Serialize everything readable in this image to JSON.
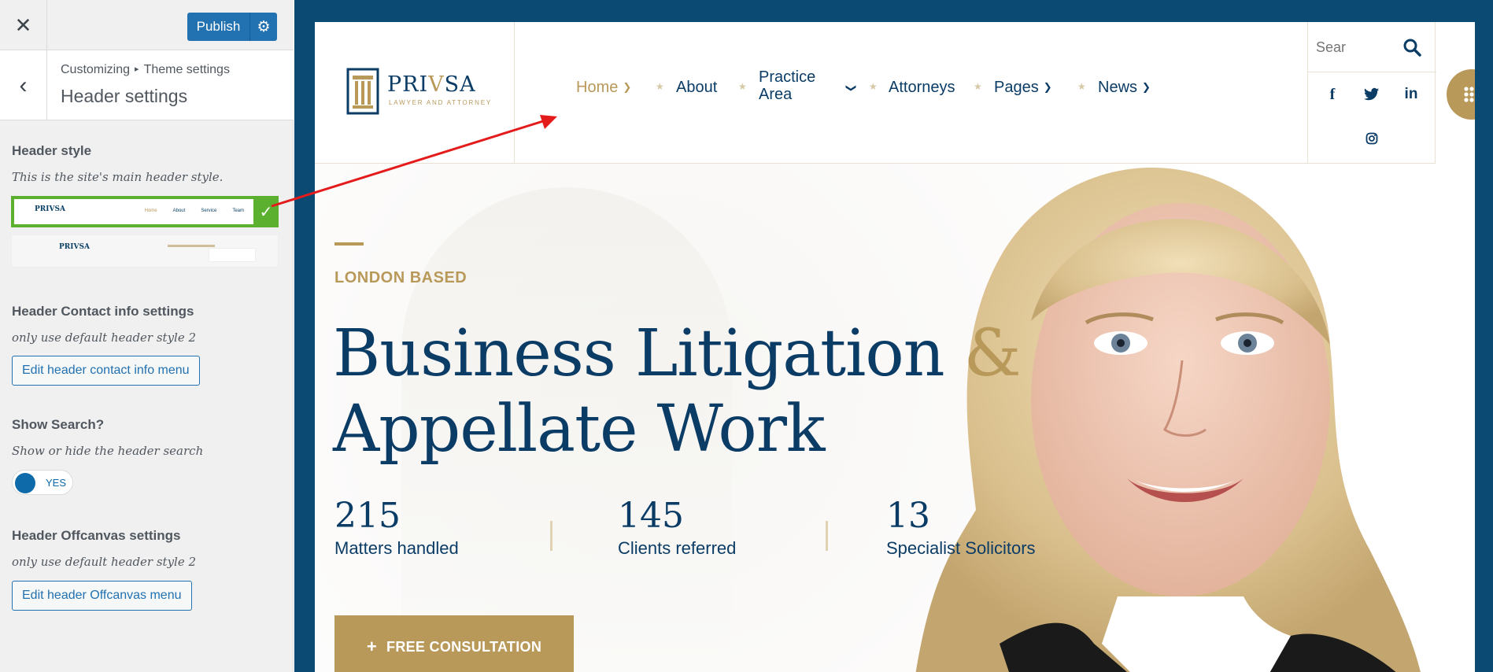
{
  "customizer": {
    "close_icon": "close-icon",
    "publish_label": "Publish",
    "gear_icon": "gear-icon",
    "back_icon": "chevron-left-icon",
    "breadcrumb": {
      "root": "Customizing",
      "separator": "▸",
      "parent": "Theme settings"
    },
    "section_title": "Header settings",
    "header_style": {
      "title": "Header style",
      "description": "This is the site's main header style.",
      "option_1_logo": "PRIVSA",
      "option_1_nav": [
        "Home",
        "About",
        "Service",
        "Team"
      ],
      "option_2_logo": "PRIVSA",
      "selected_option": 1
    },
    "contact_info": {
      "title": "Header Contact info settings",
      "description": "only use default header style 2",
      "button_label": "Edit header contact info menu"
    },
    "search": {
      "title": "Show Search?",
      "description": "Show or hide the header search",
      "toggle_label": "YES",
      "enabled": true
    },
    "offcanvas": {
      "title": "Header Offcanvas settings",
      "description": "only use default header style 2",
      "button_label": "Edit header Offcanvas menu"
    }
  },
  "site": {
    "logo": {
      "name_pre": "PRI",
      "name_v": "V",
      "name_post": "SA",
      "tagline": "LAWYER AND ATTORNEY"
    },
    "nav": [
      {
        "label": "Home",
        "has_dropdown": true,
        "active": true
      },
      {
        "label": "About",
        "has_dropdown": false
      },
      {
        "label": "Practice",
        "label2": "Area",
        "has_dropdown": true
      },
      {
        "label": "Attorneys",
        "has_dropdown": false
      },
      {
        "label": "Pages",
        "has_dropdown": true
      },
      {
        "label": "News",
        "has_dropdown": true
      }
    ],
    "search_placeholder": "Sear",
    "social": [
      "f",
      "twitter",
      "in",
      "instagram"
    ],
    "hero": {
      "kicker": "LONDON BASED",
      "headline_line1": "Business Litigation",
      "headline_amp": "&",
      "headline_line2": "Appellate Work",
      "stats": [
        {
          "number": "215",
          "label": "Matters handled"
        },
        {
          "number": "145",
          "label": "Clients referred"
        },
        {
          "number": "13",
          "label": "Specialist Solicitors"
        }
      ],
      "cta_icon": "+",
      "cta_label": "FREE CONSULTATION"
    },
    "colors": {
      "navy": "#0b3c66",
      "gold": "#b8995a",
      "frame": "#0b4a72",
      "wp_blue": "#2271b1",
      "selected_green": "#5bb12f",
      "annotation_red": "#e31b1b"
    }
  }
}
